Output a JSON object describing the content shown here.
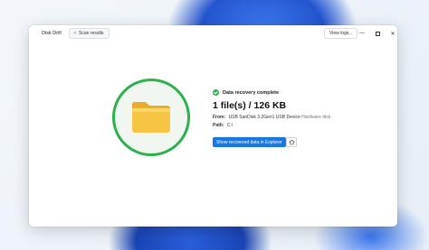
{
  "app": {
    "title": "Disk Drill"
  },
  "toolbar": {
    "back_label": "Scan results",
    "view_logs_label": "View logs...",
    "minimize_icon": "minimize-icon",
    "maximize_icon": "maximize-icon",
    "close_icon": "close-icon"
  },
  "result": {
    "status": "Data recovery complete",
    "summary": "1 file(s) / 126 KB",
    "from_label": "From:",
    "from_value": "USB  SanDisk 3.2Gen1 USB Device",
    "from_type": "Hardware disk",
    "path_label": "Path:",
    "path_value": "C:\\",
    "show_button": "Show recovered data in Explorer"
  },
  "icons": {
    "folder": "folder-icon",
    "check": "check-icon",
    "home": "home-icon"
  },
  "colors": {
    "accent": "#1679e2",
    "success": "#2bb24c",
    "folder": "#f7c544"
  }
}
